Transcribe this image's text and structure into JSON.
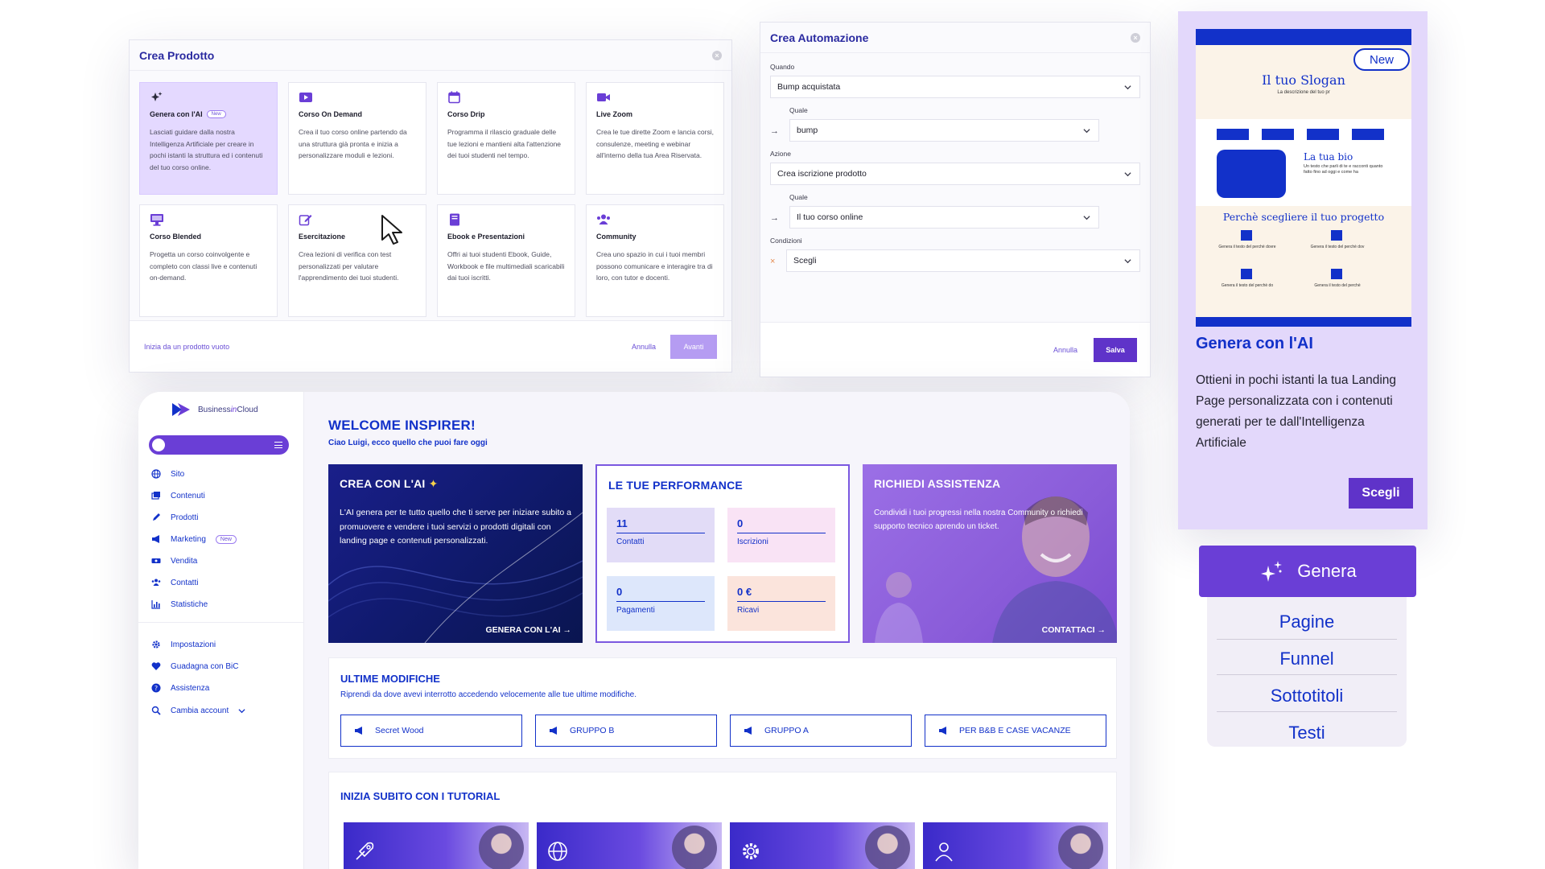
{
  "crea_prodotto": {
    "title": "Crea Prodotto",
    "cards": [
      {
        "icon": "sparkle-icon",
        "name": "Genera con l'AI",
        "badge": "New",
        "desc": "Lasciati guidare dalla nostra Intelligenza Artificiale per creare in pochi istanti la struttura ed i contenuti del tuo corso online."
      },
      {
        "icon": "play-icon",
        "name": "Corso On Demand",
        "desc": "Crea il tuo corso online partendo da una struttura già pronta e inizia a personalizzare moduli e lezioni."
      },
      {
        "icon": "calendar-icon",
        "name": "Corso Drip",
        "desc": "Programma il rilascio graduale delle tue lezioni e mantieni alta l'attenzione dei tuoi studenti nel tempo."
      },
      {
        "icon": "video-camera-icon",
        "name": "Live Zoom",
        "desc": "Crea le tue dirette Zoom e lancia corsi, consulenze, meeting e webinar all'interno della tua Area Riservata."
      },
      {
        "icon": "monitor-icon",
        "name": "Corso Blended",
        "desc": "Progetta un corso coinvolgente e completo con classi live e contenuti on-demand."
      },
      {
        "icon": "edit-icon",
        "name": "Esercitazione",
        "desc": "Crea lezioni di verifica con test personalizzati per valutare l'apprendimento dei tuoi studenti."
      },
      {
        "icon": "book-icon",
        "name": "Ebook e Presentazioni",
        "desc": "Offri ai tuoi studenti Ebook, Guide, Workbook e file multimediali scaricabili dai tuoi iscritti."
      },
      {
        "icon": "users-icon",
        "name": "Community",
        "desc": "Crea uno spazio in cui i tuoi membri possono comunicare e interagire tra di loro, con tutor e docenti."
      }
    ],
    "empty_link": "Inizia da un prodotto vuoto",
    "cancel": "Annulla",
    "next": "Avanti"
  },
  "crea_automazione": {
    "title": "Crea Automazione",
    "quando_label": "Quando",
    "quando_value": "Bump acquistata",
    "quale1_label": "Quale",
    "quale1_value": "bump",
    "azione_label": "Azione",
    "azione_value": "Crea iscrizione prodotto",
    "quale2_label": "Quale",
    "quale2_value": "Il tuo corso online",
    "condizioni_label": "Condizioni",
    "condizioni_value": "Scegli",
    "cancel": "Annulla",
    "save": "Salva"
  },
  "ai_card": {
    "preview": {
      "new_badge": "New",
      "slogan": "Il tuo Slogan",
      "slogan_sub": "La descrizione del tuo pr",
      "bio_title": "La tua bio",
      "bio_text": "Un testo che parli di te e racconti quanto fatto fino ad oggi e come ha",
      "why_title": "Perchè scegliere il tuo progetto",
      "why_items": [
        "Genera il testo del perchè dovre",
        "Genera il testo del perchè dov",
        "Genera il testo del perchè do",
        "Genera il testo del perchè"
      ]
    },
    "title": "Genera con l'AI",
    "desc": "Ottieni in pochi istanti la tua Landing Page personalizzata con i contenuti generati per te dall'Intelligenza Artificiale",
    "button": "Scegli"
  },
  "genera_menu": {
    "button": "Genera",
    "items": [
      "Pagine",
      "Funnel",
      "Sottotitoli",
      "Testi"
    ]
  },
  "dashboard": {
    "logo": {
      "pre": "Business",
      "mid": "in",
      "post": "Cloud"
    },
    "nav": [
      {
        "icon": "globe-icon",
        "label": "Sito"
      },
      {
        "icon": "content-icon",
        "label": "Contenuti"
      },
      {
        "icon": "pencil-icon",
        "label": "Prodotti"
      },
      {
        "icon": "megaphone-icon",
        "label": "Marketing",
        "badge": "New"
      },
      {
        "icon": "ticket-icon",
        "label": "Vendita"
      },
      {
        "icon": "users-icon",
        "label": "Contatti"
      },
      {
        "icon": "chart-icon",
        "label": "Statistiche"
      }
    ],
    "nav_bottom": [
      {
        "icon": "gear-icon",
        "label": "Impostazioni"
      },
      {
        "icon": "heart-icon",
        "label": "Guadagna con BiC"
      },
      {
        "icon": "question-icon",
        "label": "Assistenza"
      },
      {
        "icon": "search-icon",
        "label": "Cambia account"
      }
    ],
    "welcome": "WELCOME INSPIRER!",
    "welcome_sub": "Ciao Luigi, ecco quello che puoi fare oggi",
    "crea_ai": {
      "title": "CREA CON L'AI",
      "text": "L'AI genera per te tutto quello che ti serve per iniziare subito a promuovere e vendere i tuoi servizi o prodotti digitali con landing page e contenuti personalizzati.",
      "cta": "GENERA CON L'AI →"
    },
    "performance": {
      "title": "LE TUE PERFORMANCE",
      "stats": [
        {
          "value": "11",
          "label": "Contatti",
          "color": "#e2dcf7"
        },
        {
          "value": "0",
          "label": "Iscrizioni",
          "color": "#f9e3f5"
        },
        {
          "value": "0",
          "label": "Pagamenti",
          "color": "#dde7fb"
        },
        {
          "value": "0 €",
          "label": "Ricavi",
          "color": "#fbe4dc"
        }
      ]
    },
    "assistenza": {
      "title": "RICHIEDI ASSISTENZA",
      "text": "Condividi i tuoi progressi nella nostra Community o richiedi supporto tecnico aprendo un ticket.",
      "cta": "CONTATTACI →"
    },
    "ultime": {
      "title": "ULTIME MODIFICHE",
      "subtitle": "Riprendi da dove avevi interrotto accedendo velocemente alle tue ultime modifiche.",
      "items": [
        "Secret Wood",
        "GRUPPO B",
        "GRUPPO A",
        "PER B&B E CASE VACANZE"
      ]
    },
    "tutorial": {
      "title": "INIZIA SUBITO CON I TUTORIAL",
      "icons": [
        "rocket-icon",
        "globe-icon",
        "gear-icon",
        "user-icon"
      ]
    }
  }
}
